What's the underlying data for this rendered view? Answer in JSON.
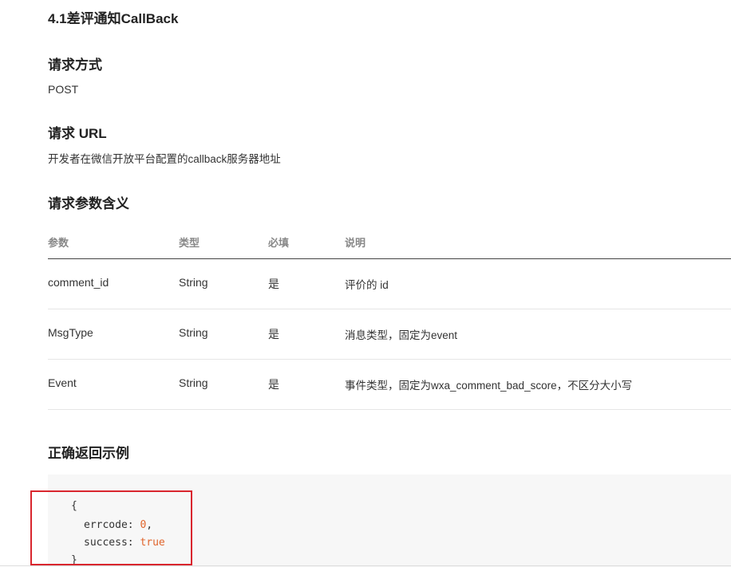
{
  "section_title": "4.1差评通知CallBack",
  "method": {
    "heading": "请求方式",
    "value": "POST"
  },
  "url": {
    "heading": "请求 URL",
    "value": "开发者在微信开放平台配置的callback服务器地址"
  },
  "params": {
    "heading": "请求参数含义",
    "columns": [
      "参数",
      "类型",
      "必填",
      "说明"
    ],
    "rows": [
      [
        "comment_id",
        "String",
        "是",
        "评价的 id"
      ],
      [
        "MsgType",
        "String",
        "是",
        "消息类型，固定为event"
      ],
      [
        "Event",
        "String",
        "是",
        "事件类型，固定为wxa_comment_bad_score，不区分大小写"
      ]
    ]
  },
  "example": {
    "heading": "正确返回示例",
    "open_brace": "{",
    "errcode_key": "errcode: ",
    "errcode_value": "0",
    "comma": ",",
    "success_key": "success: ",
    "success_value": "true",
    "close_brace": "}"
  },
  "colors": {
    "highlight_border": "#d9262e",
    "code_literal": "#e0642b",
    "code_background": "#f7f7f7"
  }
}
